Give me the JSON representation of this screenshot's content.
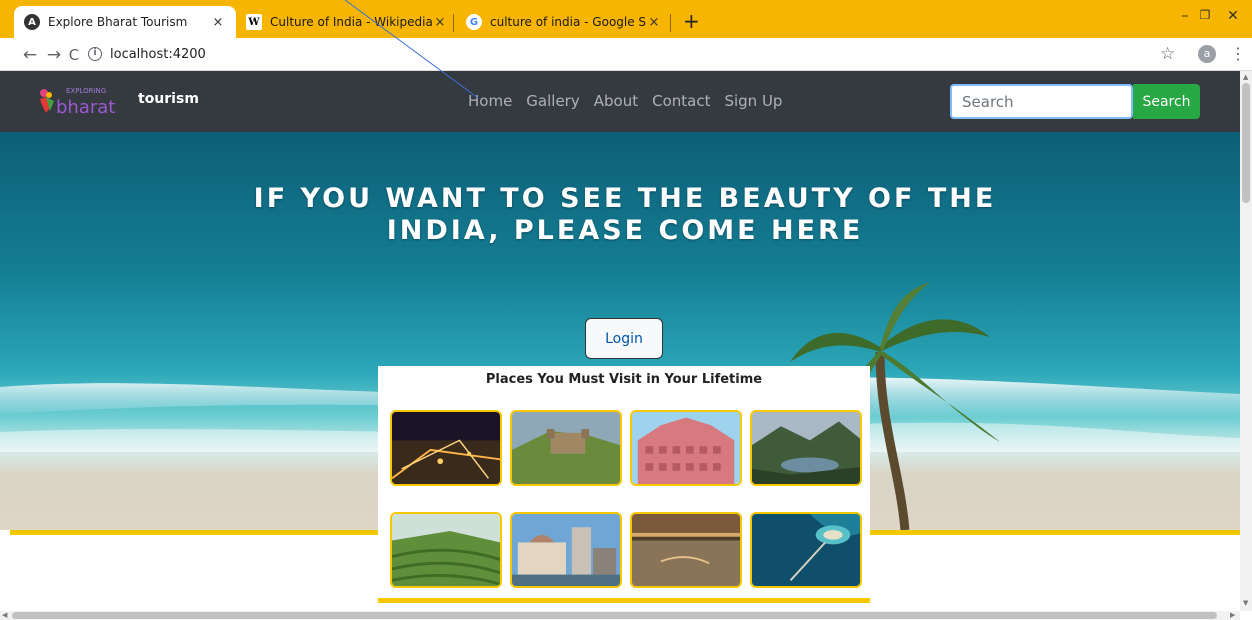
{
  "browser": {
    "tabs": [
      {
        "title": "Explore Bharat Tourism",
        "icon": "angular-icon",
        "active": true
      },
      {
        "title": "Culture of India - Wikipedia",
        "icon": "wikipedia-icon",
        "active": false
      },
      {
        "title": "culture of india - Google Search",
        "icon": "google-icon",
        "active": false
      }
    ],
    "close_glyph": "×",
    "new_tab_glyph": "+",
    "url": "localhost:4200",
    "profile_initial": "a",
    "accent_color": "#f7b500"
  },
  "navbar": {
    "logo_alt": "Exploring Bharat",
    "logo_small": "EXPLORING",
    "logo_big": "bharat",
    "brand": "tourism",
    "menu": [
      "Home",
      "Gallery",
      "About",
      "Contact",
      "Sign Up"
    ],
    "search_placeholder": "Search",
    "search_button": "Search"
  },
  "hero": {
    "headline": "IF YOU WANT TO SEE THE BEAUTY OF THE INDIA, PLEASE COME HERE",
    "login_button": "Login"
  },
  "places": {
    "title": "Places You Must Visit in Your Lifetime",
    "thumbnails": [
      "city-night-thumbnail",
      "hill-fort-thumbnail",
      "hawa-mahal-thumbnail",
      "mountain-lake-thumbnail",
      "tea-gardens-thumbnail",
      "taj-hotel-mumbai-thumbnail",
      "river-reflection-thumbnail",
      "island-lagoon-thumbnail"
    ]
  },
  "colors": {
    "navbar": "#343a40",
    "search_button": "#28a745",
    "yellow": "#f5c800"
  }
}
